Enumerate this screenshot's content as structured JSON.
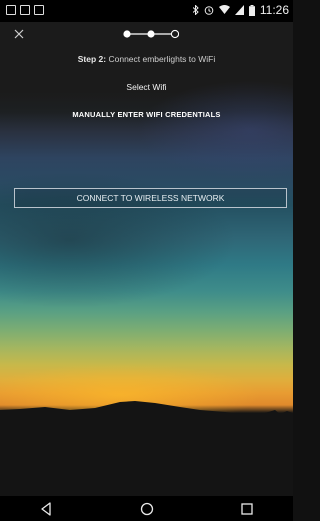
{
  "status_bar": {
    "time": "11:26",
    "icons": [
      "notification-icon",
      "image-icon",
      "screenshot-icon",
      "bluetooth-icon",
      "alarm-icon",
      "wifi-icon",
      "signal-icon",
      "battery-icon"
    ]
  },
  "header": {
    "close_icon": "close-icon",
    "stepper": {
      "total_steps": 3,
      "current_step": 2
    }
  },
  "content": {
    "step_label": "Step 2:",
    "step_text": " Connect emberlights to WiFi",
    "select_wifi": "Select Wifi",
    "manual_link": "MANUALLY ENTER WIFI CREDENTIALS",
    "connect_button": "CONNECT TO WIRELESS NETWORK"
  },
  "nav_bar": {
    "icons": [
      "back-icon",
      "home-icon",
      "recents-icon"
    ]
  },
  "colors": {
    "accent_white": "#ffffff",
    "button_border": "#b9c3cc",
    "sunset_orange": "#e89c32"
  }
}
